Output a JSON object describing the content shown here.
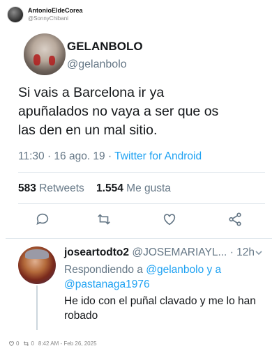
{
  "outer": {
    "name": "AntonioEldeCorea",
    "handle": "@SonnyChibani",
    "likes": "0",
    "retweets": "0",
    "timestamp": "8:42 AM - Feb 26, 2025"
  },
  "tweet": {
    "name": "GELANBOLO",
    "handle": "@gelanbolo",
    "text_line1": "Si vais a Barcelona ir ya",
    "text_line2": "apuñalados no vaya a ser que os",
    "text_line3": "las den en un mal sitio.",
    "meta_time": "11:30 · 16 ago. 19 · ",
    "meta_app": "Twitter for Android",
    "retweets_count": "583",
    "retweets_label": "Retweets",
    "likes_count": "1.554",
    "likes_label": "Me gusta"
  },
  "reply": {
    "name": "joseartodto2",
    "handle": "@JOSEMARIAYL...",
    "time": "· 12h",
    "replying_prefix": "Respondiendo a ",
    "mention1": "@gelanbolo",
    "replying_join": " y a",
    "mention2": "@pastanaga1976",
    "text_line1": "He ido con el puñal clavado y me lo han",
    "text_line2": "robado"
  },
  "colors": {
    "accent": "#1da1f2",
    "secondary_text": "#657786",
    "primary_text": "#14171a"
  },
  "icons": [
    "reply-icon",
    "retweet-icon",
    "like-icon",
    "share-icon",
    "chevron-down-icon"
  ]
}
